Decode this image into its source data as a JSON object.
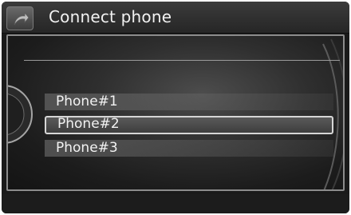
{
  "header": {
    "title": "Connect phone",
    "back_icon": "back-arrow-icon"
  },
  "phones": [
    {
      "label": "Phone#1",
      "selected": false
    },
    {
      "label": "Phone#2",
      "selected": true
    },
    {
      "label": "Phone#3",
      "selected": false
    }
  ],
  "colors": {
    "background": "#1a1a1a",
    "text": "#f2f2f2",
    "highlight_border": "#d6d6d6"
  }
}
